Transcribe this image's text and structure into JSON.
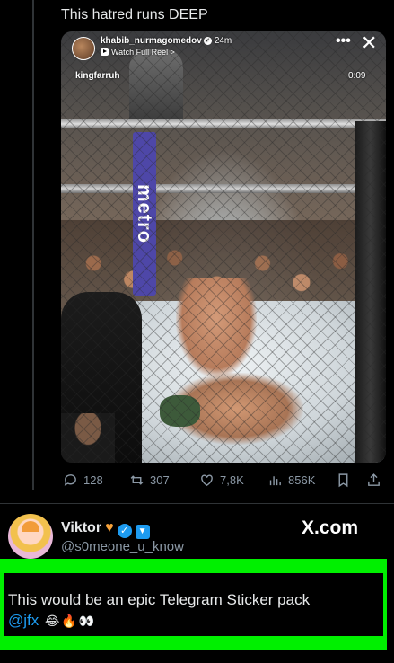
{
  "tweet": {
    "text": "This hatred runs DEEP"
  },
  "reel": {
    "username": "khabib_nurmagomedov",
    "time": "24m",
    "watch_label": "Watch Full Reel >",
    "author_tag": "kingfarruh",
    "duration": "0:09",
    "banner_text": "metro",
    "more_icon": "more-dots-icon",
    "close_icon": "close-icon"
  },
  "actions": {
    "replies": "128",
    "retweets": "307",
    "likes": "7,8K",
    "views": "856K"
  },
  "comment": {
    "name": "Viktor",
    "handle": "@s0meone_u_know",
    "site": "X.com",
    "text": "This would be an epic Telegram Sticker pack",
    "mention": "@jfx",
    "emojis": [
      "😂",
      "🔥",
      "👀"
    ]
  },
  "colors": {
    "highlight": "#00f000",
    "link": "#1d9bf0",
    "muted": "#8b98a5"
  }
}
